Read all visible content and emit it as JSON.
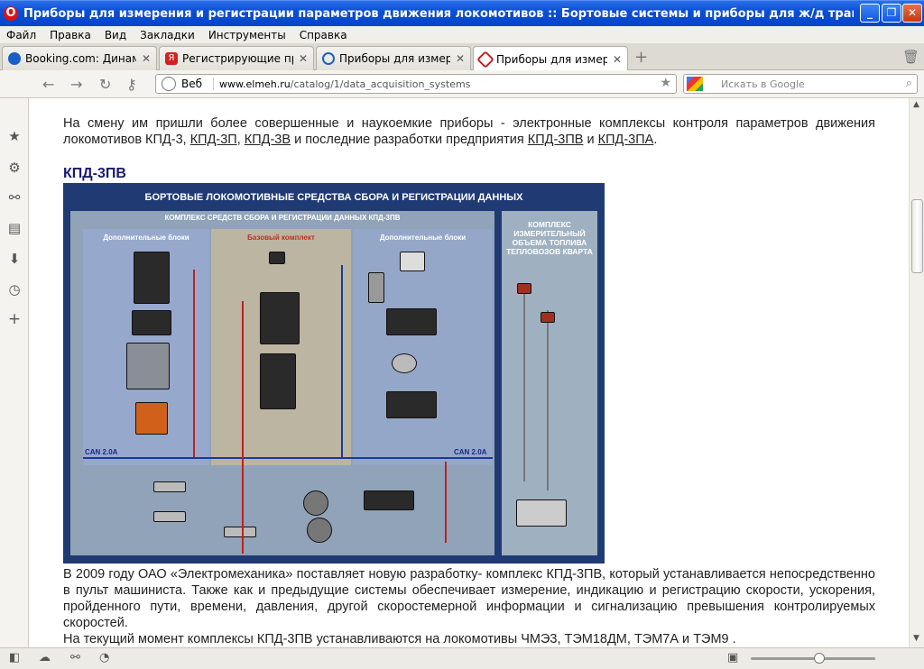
{
  "window": {
    "title": "Приборы для измерения и регистрации параметров движения локомотивов :: Бортовые системы и приборы для ж/д транспорта :: Ката... - О...",
    "controls": {
      "minimize": "_",
      "restore": "❐",
      "close": "✕"
    }
  },
  "menu": [
    "Файл",
    "Правка",
    "Вид",
    "Закладки",
    "Инструменты",
    "Справка"
  ],
  "tabs": [
    {
      "label": "Booking.com: Динамикс ...",
      "favicon_color": "#1a5fc8",
      "active": false
    },
    {
      "label": "Регистрирующие приб...",
      "favicon_color": "#d42020",
      "active": false
    },
    {
      "label": "Приборы для измерени...",
      "favicon_color": "#2060c0",
      "active": false
    },
    {
      "label": "Приборы для измерени...",
      "favicon_color": "#c02020",
      "active": true
    }
  ],
  "navbar": {
    "web_label": "Веб",
    "url_host": "www.elmeh.ru",
    "url_path": "/catalog/1/data_acquisition_systems",
    "search_placeholder": "Искать в Google"
  },
  "content": {
    "intro_text": "На смену им пришли более совершенные и наукоемкие приборы - электронные комплексы контроля параметров движения локомотивов КПД-3,",
    "links": [
      "КПД-3П",
      "КПД-3В",
      "КПД-3ПВ",
      "КПД-3ПА"
    ],
    "intro_mid": "и последние разработки предприятия",
    "intro_and": "и",
    "heading": "КПД-3ПВ",
    "paragraph2": "В 2009 году ОАО «Электромеханика» поставляет новую разработку- комплекс КПД-3ПВ, который устанавливается непосредственно в пульт машиниста. Также как и предыдущие системы обеспечивает измерение, индикацию и регистрацию скорости, ускорения, пройденного пути, времени, давления, другой скоростемерной информации и сигнализацию превышения контролируемых скоростей.",
    "paragraph3": "На текущий момент комплексы КПД-3ПВ устанавливаются на локомотивы ЧМЭ3, ТЭМ18ДМ, ТЭМ7А и ТЭМ9 ."
  },
  "poster": {
    "title": "БОРТОВЫЕ ЛОКОМОТИВНЫЕ СРЕДСТВА СБОРА И РЕГИСТРАЦИИ ДАННЫХ",
    "subtitle": "КОМПЛЕКС СРЕДСТВ СБОРА И РЕГИСТРАЦИИ ДАННЫХ КПД-3ПВ",
    "col_left": "Дополнительные блоки",
    "col_mid": "Базовый комплект",
    "col_right": "Дополнительные блоки",
    "can_left": "CAN 2.0A",
    "can_right": "CAN 2.0A",
    "side_title": "КОМПЛЕКС ИЗМЕРИТЕЛЬНЫЙ ОБЪЕМА ТОПЛИВА ТЕПЛОВОЗОВ КВАРТА",
    "colors": {
      "frame": "#203a74",
      "accent_red": "#c03020"
    }
  }
}
